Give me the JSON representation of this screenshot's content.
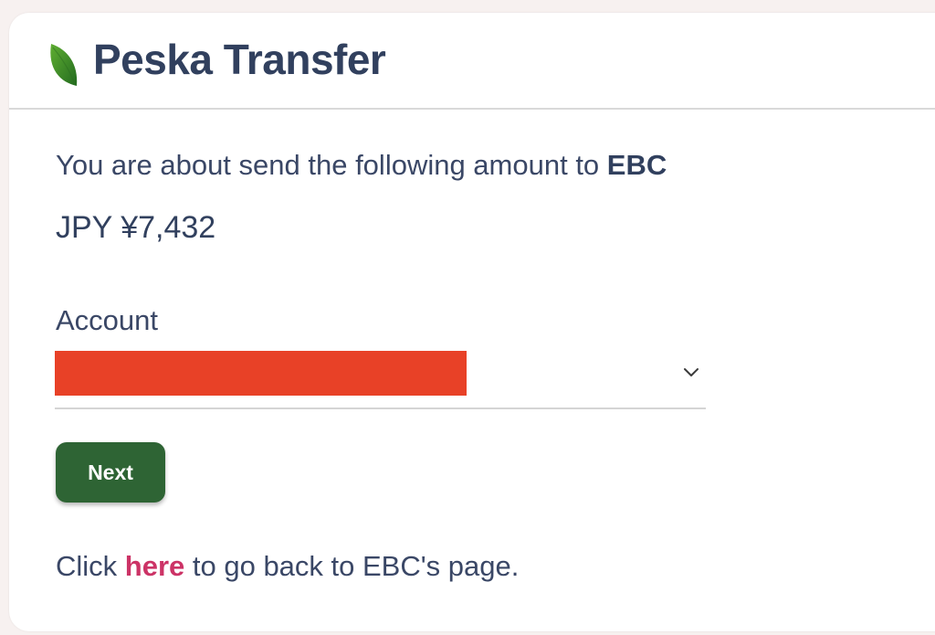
{
  "header": {
    "brand": "Peska Transfer",
    "logo_icon": "leaf-icon"
  },
  "transfer": {
    "intro_text": "You are about send the following amount to ",
    "recipient": "EBC",
    "amount": "JPY ¥7,432"
  },
  "account": {
    "label": "Account",
    "selected_value_redacted": true,
    "dropdown_icon": "chevron-down-icon"
  },
  "actions": {
    "next_label": "Next"
  },
  "footer": {
    "prefix": "Click ",
    "link_text": "here",
    "suffix": " to go back to EBC's page."
  },
  "colors": {
    "brand_text": "#31405e",
    "button_bg": "#2e6434",
    "link": "#cc3366",
    "redaction": "#e84127",
    "leaf": "#3d8a2a"
  }
}
